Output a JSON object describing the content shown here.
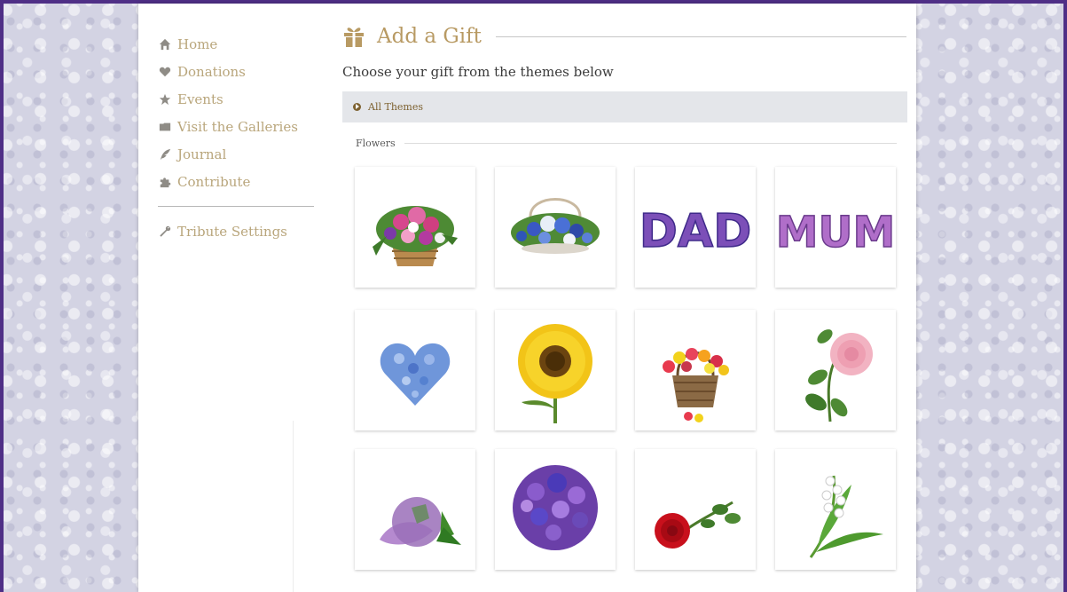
{
  "sidebar": {
    "items": [
      {
        "label": "Home",
        "icon": "home-icon"
      },
      {
        "label": "Donations",
        "icon": "heart-icon"
      },
      {
        "label": "Events",
        "icon": "star-icon"
      },
      {
        "label": "Visit the Galleries",
        "icon": "gallery-icon"
      },
      {
        "label": "Journal",
        "icon": "quill-icon"
      },
      {
        "label": "Contribute",
        "icon": "puzzle-icon"
      }
    ],
    "settings": {
      "label": "Tribute Settings",
      "icon": "wrench-icon"
    }
  },
  "main": {
    "title": "Add a Gift",
    "subtitle": "Choose your gift from the themes below",
    "themes_label": "All Themes",
    "section_label": "Flowers",
    "gifts": [
      {
        "icon": "flower-basket-pink-icon"
      },
      {
        "icon": "flower-basket-blue-icon"
      },
      {
        "icon": "dad-flower-letters-icon",
        "text": "DAD"
      },
      {
        "icon": "mum-flower-letters-icon",
        "text": "MUM"
      },
      {
        "icon": "blue-flower-heart-icon"
      },
      {
        "icon": "sunflower-icon"
      },
      {
        "icon": "tulip-basket-icon"
      },
      {
        "icon": "pink-rose-icon"
      },
      {
        "icon": "lilac-icon"
      },
      {
        "icon": "purple-bouquet-icon"
      },
      {
        "icon": "red-rose-icon"
      },
      {
        "icon": "lily-of-the-valley-icon"
      }
    ]
  },
  "colors": {
    "accent": "#b89a63",
    "nav_text": "#b9a67c",
    "frame": "#4f2f86",
    "themes_bar": "#e4e6ea"
  }
}
